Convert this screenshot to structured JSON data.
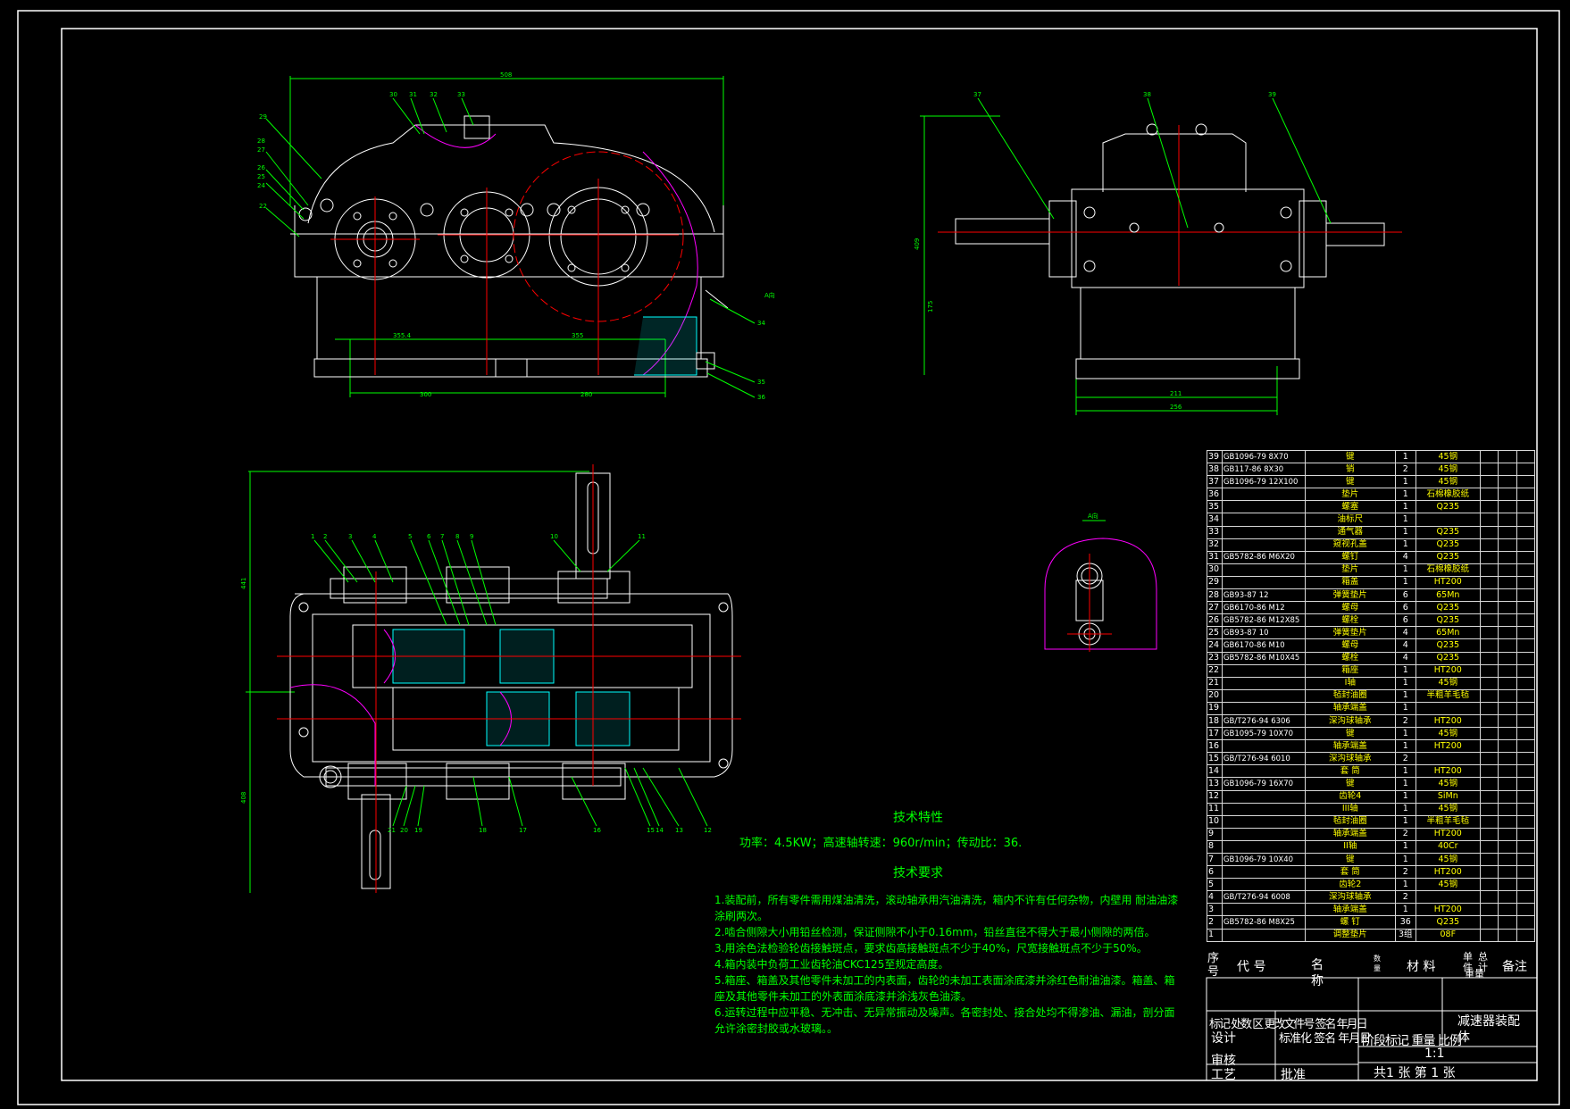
{
  "bom_rows": [
    {
      "no": "39",
      "code": "GB1096-79  8X70",
      "name": "键",
      "qty": "1",
      "mat": "45钢"
    },
    {
      "no": "38",
      "code": "GB117-86  8X30",
      "name": "销",
      "qty": "2",
      "mat": "45钢"
    },
    {
      "no": "37",
      "code": "GB1096-79  12X100",
      "name": "键",
      "qty": "1",
      "mat": "45钢"
    },
    {
      "no": "36",
      "code": "",
      "name": "垫片",
      "qty": "1",
      "mat": "石棉橡胶纸"
    },
    {
      "no": "35",
      "code": "",
      "name": "螺塞",
      "qty": "1",
      "mat": "Q235"
    },
    {
      "no": "34",
      "code": "",
      "name": "油标尺",
      "qty": "1",
      "mat": ""
    },
    {
      "no": "33",
      "code": "",
      "name": "通气器",
      "qty": "1",
      "mat": "Q235"
    },
    {
      "no": "32",
      "code": "",
      "name": "窥视孔盖",
      "qty": "1",
      "mat": "Q235"
    },
    {
      "no": "31",
      "code": "GB5782-86  M6X20",
      "name": "螺钉",
      "qty": "4",
      "mat": "Q235"
    },
    {
      "no": "30",
      "code": "",
      "name": "垫片",
      "qty": "1",
      "mat": "石棉橡胶纸"
    },
    {
      "no": "29",
      "code": "",
      "name": "箱盖",
      "qty": "1",
      "mat": "HT200"
    },
    {
      "no": "28",
      "code": "GB93-87  12",
      "name": "弹簧垫片",
      "qty": "6",
      "mat": "65Mn"
    },
    {
      "no": "27",
      "code": "GB6170-86  M12",
      "name": "螺母",
      "qty": "6",
      "mat": "Q235"
    },
    {
      "no": "26",
      "code": "GB5782-86  M12X85",
      "name": "螺栓",
      "qty": "6",
      "mat": "Q235"
    },
    {
      "no": "25",
      "code": "GB93-87  10",
      "name": "弹簧垫片",
      "qty": "4",
      "mat": "65Mn"
    },
    {
      "no": "24",
      "code": "GB6170-86  M10",
      "name": "螺母",
      "qty": "4",
      "mat": "Q235"
    },
    {
      "no": "23",
      "code": "GB5782-86  M10X45",
      "name": "螺栓",
      "qty": "4",
      "mat": "Q235"
    },
    {
      "no": "22",
      "code": "",
      "name": "箱座",
      "qty": "1",
      "mat": "HT200"
    },
    {
      "no": "21",
      "code": "",
      "name": "I轴",
      "qty": "1",
      "mat": "45钢"
    },
    {
      "no": "20",
      "code": "",
      "name": "毡封油圈",
      "qty": "1",
      "mat": "半粗羊毛毡"
    },
    {
      "no": "19",
      "code": "",
      "name": "轴承端盖",
      "qty": "1",
      "mat": ""
    },
    {
      "no": "18",
      "code": "GB/T276-94  6306",
      "name": "深沟球轴承",
      "qty": "2",
      "mat": "HT200"
    },
    {
      "no": "17",
      "code": "GB1095-79  10X70",
      "name": "键",
      "qty": "1",
      "mat": "45钢"
    },
    {
      "no": "16",
      "code": "",
      "name": "轴承端盖",
      "qty": "1",
      "mat": "HT200"
    },
    {
      "no": "15",
      "code": "GB/T276-94  6010",
      "name": "深沟球轴承",
      "qty": "2",
      "mat": ""
    },
    {
      "no": "14",
      "code": "",
      "name": "套 筒",
      "qty": "1",
      "mat": "HT200"
    },
    {
      "no": "13",
      "code": "GB1096-79  16X70",
      "name": "键",
      "qty": "1",
      "mat": "45钢"
    },
    {
      "no": "12",
      "code": "",
      "name": "齿轮4",
      "qty": "1",
      "mat": "SiMn"
    },
    {
      "no": "11",
      "code": "",
      "name": "III轴",
      "qty": "1",
      "mat": "45钢"
    },
    {
      "no": "10",
      "code": "",
      "name": "毡封油圈",
      "qty": "1",
      "mat": "半粗羊毛毡"
    },
    {
      "no": "9",
      "code": "",
      "name": "轴承端盖",
      "qty": "2",
      "mat": "HT200"
    },
    {
      "no": "8",
      "code": "",
      "name": "II轴",
      "qty": "1",
      "mat": "40Cr"
    },
    {
      "no": "7",
      "code": "GB1096-79  10X40",
      "name": "键",
      "qty": "1",
      "mat": "45钢"
    },
    {
      "no": "6",
      "code": "",
      "name": "套 筒",
      "qty": "2",
      "mat": "HT200"
    },
    {
      "no": "5",
      "code": "",
      "name": "齿轮2",
      "qty": "1",
      "mat": "45钢"
    },
    {
      "no": "4",
      "code": "GB/T276-94  6008",
      "name": "深沟球轴承",
      "qty": "2",
      "mat": ""
    },
    {
      "no": "3",
      "code": "",
      "name": "轴承端盖",
      "qty": "1",
      "mat": "HT200"
    },
    {
      "no": "2",
      "code": "GB5782-86  M8X25",
      "name": "螺 钉",
      "qty": "36",
      "mat": "Q235"
    },
    {
      "no": "1",
      "code": "",
      "name": "调整垫片",
      "qty": "3组",
      "mat": "08F"
    }
  ],
  "bom_header": {
    "seq": "序号",
    "code": "代  号",
    "name": "名  称",
    "qty": "数量",
    "material": "材  料",
    "unit": "单件",
    "total": "总计",
    "weight": "重量",
    "remark": "备注"
  },
  "title_block": {
    "mark_row": "标记 处数 区 更改文件号 签名 年月日",
    "design": "设计",
    "standardize": "标准化 签名 年月日",
    "review": "审核",
    "process": "工艺",
    "approve": "批准",
    "stage": "阶段标记 重量 比例",
    "scale": "1:1",
    "sheets": "共1 张  第 1 张",
    "drawing_name": "减速器装配体"
  },
  "tech_char": {
    "title": "技术特性",
    "line": "功率：4.5KW；高速轴转速：960r/min；传动比：36."
  },
  "tech_req": {
    "title": "技术要求",
    "items": [
      "1.装配前，所有零件需用煤油清洗，滚动轴承用汽油清洗，箱内不许有任何杂物，内壁用 耐油油漆涂刷两次。",
      "2.啮合侧隙大小用铅丝检测，保证侧隙不小于0.16mm，铅丝直径不得大于最小侧隙的两倍。",
      "3.用涂色法检验轮齿接触斑点，要求齿高接触斑点不少于40%，尺宽接触斑点不少于50%。",
      "4.箱内装中负荷工业齿轮油CKC125至规定高度。",
      "5.箱座、箱盖及其他零件未加工的内表面，齿轮的未加工表面涂底漆并涂红色耐油油漆。箱盖、箱座及其他零件未加工的外表面涂底漆并涂浅灰色油漆。",
      "6.运转过程中应平稳、无冲击、无异常振动及噪声。各密封处、接合处均不得渗油、漏油，剖分面允许涂密封胶或水玻璃。。"
    ]
  },
  "view_labels": {
    "section_a": "A向",
    "dim_front_total": "508",
    "dim_front_bottom_a": "300",
    "dim_front_bottom_b": "280",
    "dim_front_inner_a": "355.4",
    "dim_front_inner_b": "355",
    "dim_side_bottom_a": "211",
    "dim_side_bottom_b": "256",
    "dim_side_height": "409",
    "dim_side_height_b": "175",
    "dim_plan_width": "441",
    "dim_plan_height": "408"
  },
  "balloons_front": [
    "30",
    "31",
    "32",
    "33",
    "29",
    "28",
    "27",
    "26",
    "25",
    "24",
    "23",
    "22",
    "34",
    "35",
    "36"
  ],
  "balloons_side": [
    "37",
    "38",
    "39"
  ],
  "balloons_plan_top": [
    "1",
    "2",
    "3",
    "4",
    "5",
    "6",
    "7",
    "8",
    "9",
    "10",
    "11"
  ],
  "balloons_plan_bottom": [
    "21",
    "20",
    "19",
    "18",
    "17",
    "16",
    "15",
    "14",
    "13",
    "12"
  ],
  "colors": {
    "frame": "#ffffff",
    "outline": "#ffffff",
    "dimension": "#00ff00",
    "center": "#ff0000",
    "hatch": "#00ffff",
    "break": "#ff00ff",
    "fastener": "#ffff00"
  }
}
